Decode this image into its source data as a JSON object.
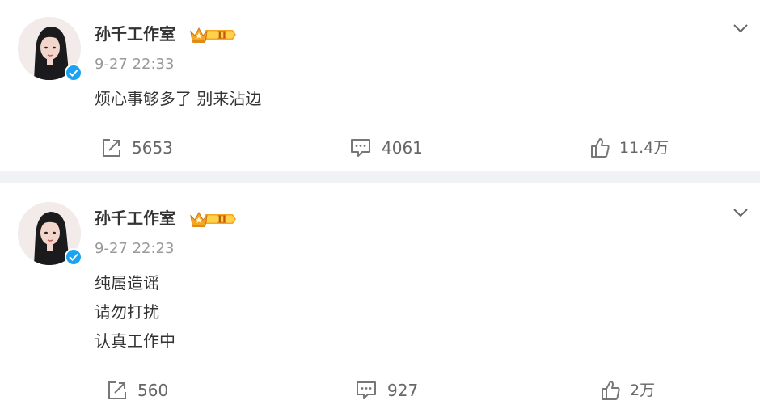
{
  "posts": [
    {
      "author": "孙千工作室",
      "time": "9-27 22:33",
      "lines": [
        "烦心事够多了 别来沾边"
      ],
      "repost_count": "5653",
      "comment_count": "4061",
      "like_count": "11.4万"
    },
    {
      "author": "孙千工作室",
      "time": "9-27 22:23",
      "lines": [
        "纯属造谣",
        "请勿打扰",
        "认真工作中"
      ],
      "repost_count": "560",
      "comment_count": "927",
      "like_count": "2万"
    }
  ],
  "badge_level": "II",
  "icons": {
    "avatar": "avatar-photo",
    "verified": "verified-check-icon",
    "badge": "vip-crown-badge-icon",
    "more": "chevron-down-icon",
    "repost": "repost-icon",
    "comment": "comment-icon",
    "like": "thumbs-up-icon"
  },
  "colors": {
    "verified_blue": "#1aa3f1",
    "badge_orange": "#f6a623",
    "separator": "#f1f2f5",
    "time_gray": "#999999"
  }
}
